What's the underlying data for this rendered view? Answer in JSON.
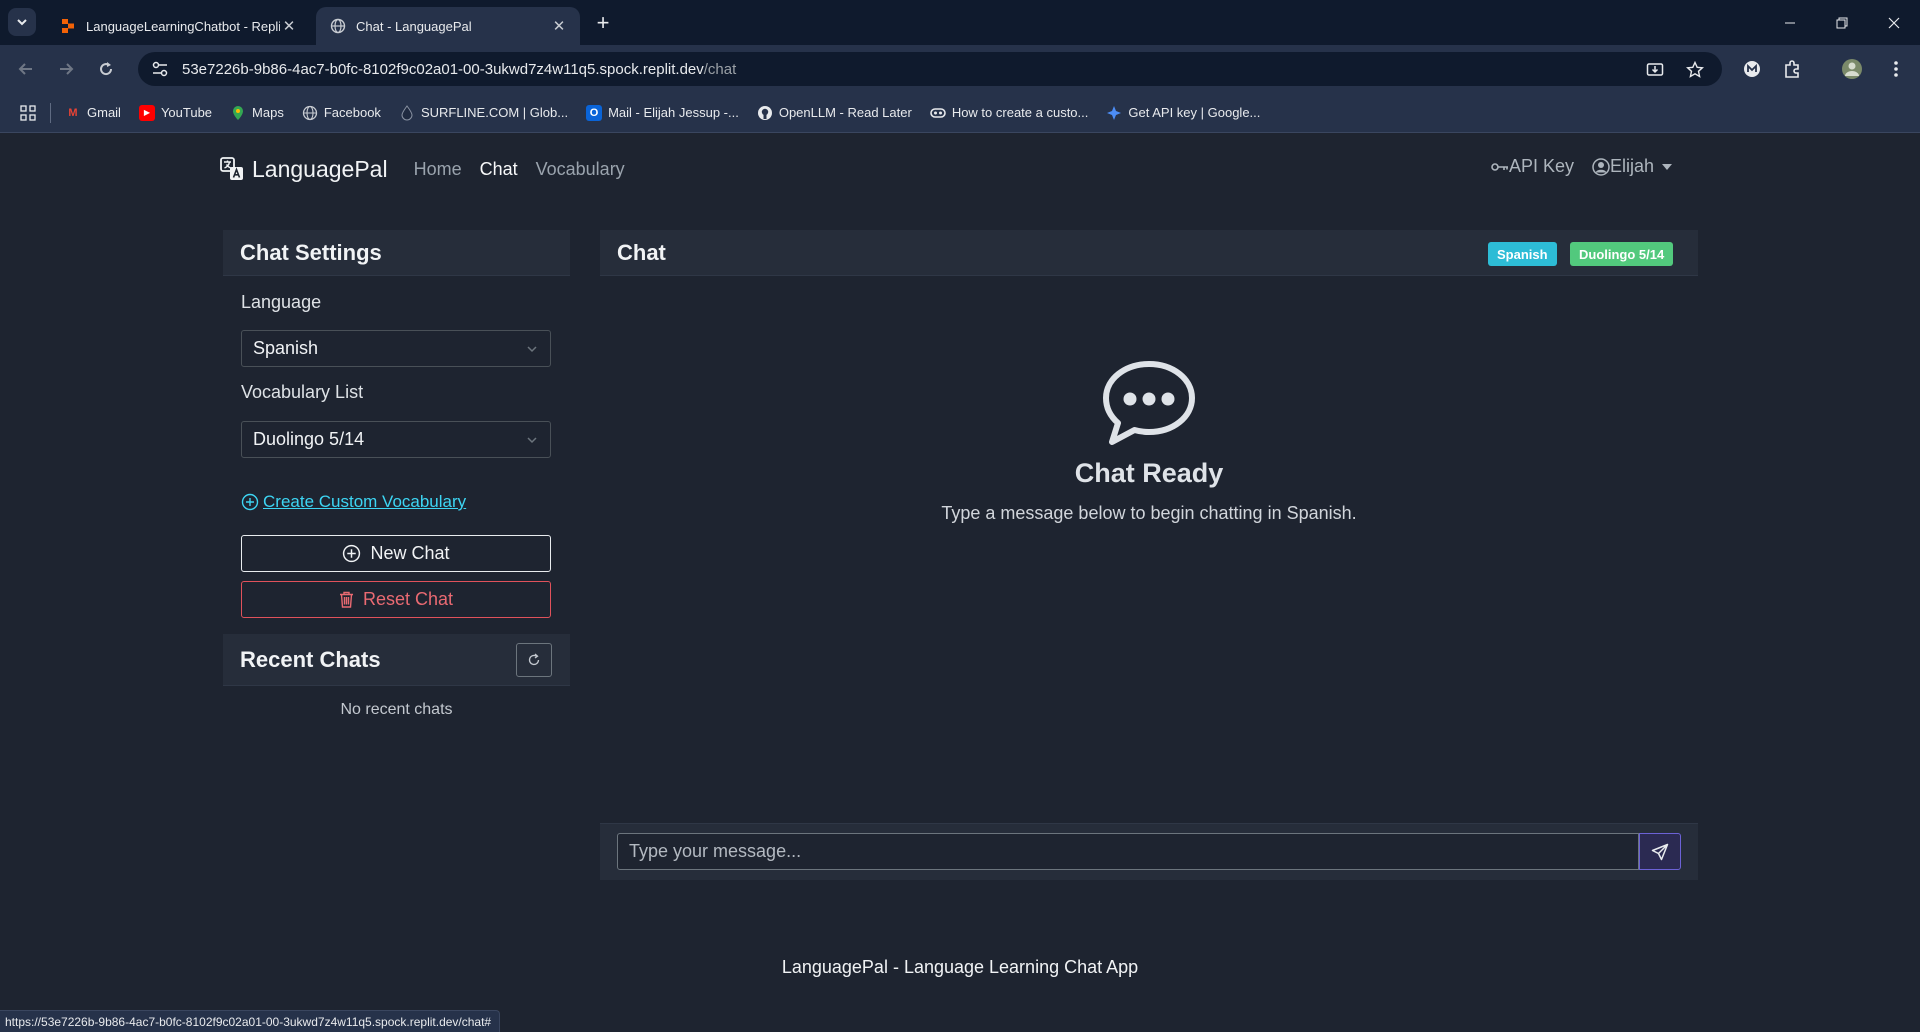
{
  "browser": {
    "tabs": [
      {
        "title": "LanguageLearningChatbot - Replit",
        "active": false,
        "favicon": "replit-icon"
      },
      {
        "title": "Chat - LanguagePal",
        "active": true,
        "favicon": "globe-icon"
      }
    ],
    "url_host": "53e7226b-9b86-4ac7-b0fc-8102f9c02a01-00-3ukwd7z4w11q5.spock.replit.dev",
    "url_path": "/chat",
    "bookmarks": [
      {
        "label": "Gmail",
        "icon": "gmail-icon"
      },
      {
        "label": "YouTube",
        "icon": "youtube-icon"
      },
      {
        "label": "Maps",
        "icon": "maps-icon"
      },
      {
        "label": "Facebook",
        "icon": "globe-icon"
      },
      {
        "label": "SURFLINE.COM | Glob...",
        "icon": "surfline-icon"
      },
      {
        "label": "Mail - Elijah Jessup -...",
        "icon": "outlook-icon"
      },
      {
        "label": "OpenLLM - Read Later",
        "icon": "github-icon"
      },
      {
        "label": "How to create a custo...",
        "icon": "link-icon"
      },
      {
        "label": "Get API key | Google...",
        "icon": "google-ai-icon"
      }
    ],
    "status_url": "https://53e7226b-9b86-4ac7-b0fc-8102f9c02a01-00-3ukwd7z4w11q5.spock.replit.dev/chat#"
  },
  "nav": {
    "brand": "LanguagePal",
    "links": [
      "Home",
      "Chat",
      "Vocabulary"
    ],
    "active_link": "Chat",
    "api_key": "API Key",
    "user": "Elijah"
  },
  "settings": {
    "title": "Chat Settings",
    "language_label": "Language",
    "language_value": "Spanish",
    "vocab_label": "Vocabulary List",
    "vocab_value": "Duolingo 5/14",
    "create_link": "Create Custom Vocabulary",
    "new_chat": "New Chat",
    "reset_chat": "Reset Chat"
  },
  "recent": {
    "title": "Recent Chats",
    "empty": "No recent chats"
  },
  "chat": {
    "title": "Chat",
    "badge_language": "Spanish",
    "badge_vocab": "Duolingo 5/14",
    "ready_title": "Chat Ready",
    "ready_subtitle": "Type a message below to begin chatting in Spanish.",
    "input_placeholder": "Type your message..."
  },
  "footer": "LanguagePal - Language Learning Chat App",
  "colors": {
    "bg": "#1e2430",
    "card_header": "#262d3a",
    "info_badge": "#2dbcd6",
    "success_badge": "#52c97d",
    "danger": "#ea6a72",
    "link": "#3dd5f3"
  }
}
